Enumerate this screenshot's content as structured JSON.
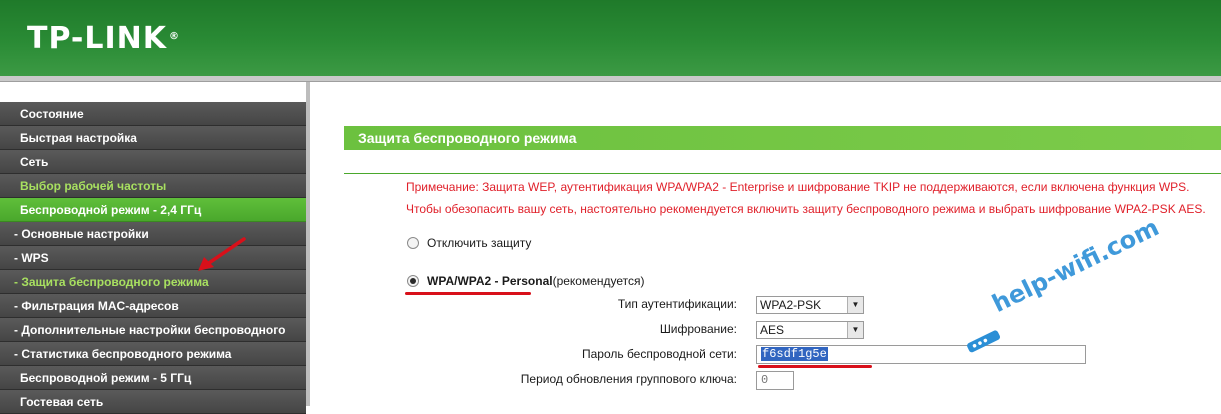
{
  "header": {
    "logo": "TP-LINK",
    "logo_mark": "®"
  },
  "sidebar": {
    "items": [
      {
        "label": "Состояние"
      },
      {
        "label": "Быстрая настройка"
      },
      {
        "label": "Сеть"
      },
      {
        "label": "Выбор рабочей частоты"
      },
      {
        "label": "Беспроводной режим - 2,4 ГГц"
      },
      {
        "label": "- Основные настройки"
      },
      {
        "label": "- WPS"
      },
      {
        "label": "- Защита беспроводного режима"
      },
      {
        "label": "- Фильтрация MAC-адресов"
      },
      {
        "label": "- Дополнительные настройки беспроводного"
      },
      {
        "label": "- Статистика беспроводного режима"
      },
      {
        "label": "Беспроводной режим - 5 ГГц"
      },
      {
        "label": "Гостевая сеть"
      }
    ]
  },
  "main": {
    "section_title": "Защита беспроводного режима",
    "note_line1": "Примечание: Защита WEP, аутентификация WPA/WPA2 - Enterprise и шифрование TKIP не поддерживаются, если включена функция WPS.",
    "note_line2": "Чтобы обезопасить вашу сеть, настоятельно рекомендуется включить защиту беспроводного режима и выбрать шифрование WPA2-PSK AES.",
    "option_disable": "Отключить защиту",
    "option_wpa": "WPA/WPA2 - Personal",
    "option_wpa_suffix": "(рекомендуется)",
    "auth_type_label": "Тип аутентификации:",
    "auth_type_value": "WPA2-PSK",
    "encryption_label": "Шифрование:",
    "encryption_value": "AES",
    "password_label": "Пароль беспроводной сети:",
    "password_value": "f6sdf1g5e",
    "group_key_label": "Период обновления группового ключа:",
    "group_key_value": "0"
  },
  "watermark": {
    "text": "help-wifi.com"
  },
  "colors": {
    "header_green": "#2a8b35",
    "accent_green": "#6cc13f",
    "note_red": "#e0202a",
    "annotation_red": "#d8101a",
    "watermark_blue": "#2b8fd6"
  }
}
